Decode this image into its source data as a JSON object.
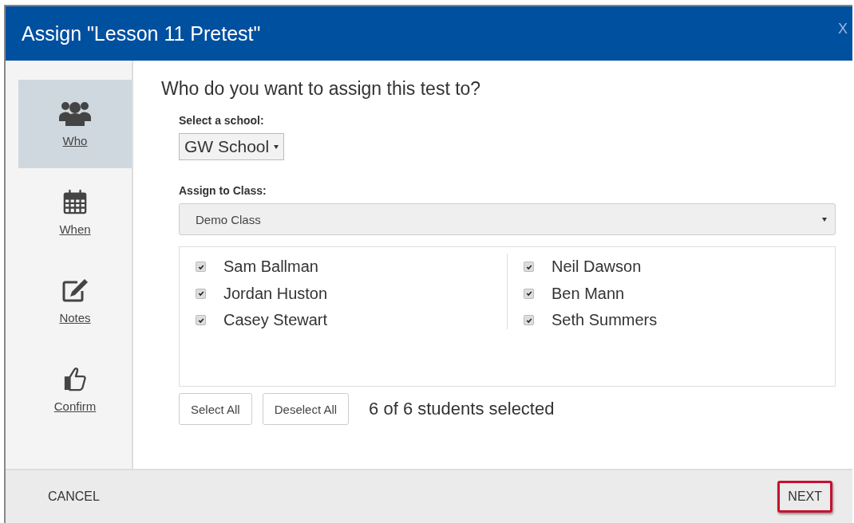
{
  "dialog": {
    "title": "Assign \"Lesson 11 Pretest\"",
    "close": "X"
  },
  "steps": [
    {
      "kind": "who",
      "label": "Who",
      "selected": true
    },
    {
      "kind": "when",
      "label": "When",
      "selected": false
    },
    {
      "kind": "notes",
      "label": "Notes",
      "selected": false
    },
    {
      "kind": "confirm",
      "label": "Confirm",
      "selected": false
    }
  ],
  "question": "Who do you want to assign this test to?",
  "school": {
    "label": "Select a school:",
    "value": "GW School"
  },
  "class": {
    "label": "Assign to Class:",
    "value": "Demo Class"
  },
  "students": [
    [
      {
        "name": "Sam Ballman",
        "checked": true
      },
      {
        "name": "Jordan Huston",
        "checked": true
      },
      {
        "name": "Casey Stewart",
        "checked": true
      }
    ],
    [
      {
        "name": "Neil Dawson",
        "checked": true
      },
      {
        "name": "Ben Mann",
        "checked": true
      },
      {
        "name": "Seth Summers",
        "checked": true
      }
    ]
  ],
  "buttons": [
    "Select All",
    "Deselect All"
  ],
  "selection_count": "6 of 6 students selected",
  "footer": {
    "cancel": "CANCEL",
    "next": {
      "label": "NEXT",
      "highlighted": true
    }
  }
}
